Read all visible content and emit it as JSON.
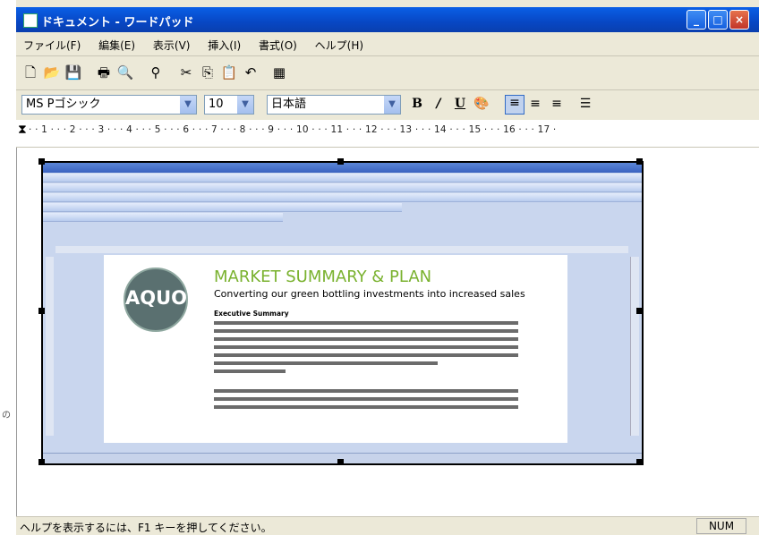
{
  "window": {
    "title": "ドキュメント - ワードパッド"
  },
  "menu": [
    "ファイル(F)",
    "編集(E)",
    "表示(V)",
    "挿入(I)",
    "書式(O)",
    "ヘルプ(H)"
  ],
  "toolbar": {
    "icons": [
      "new-icon",
      "open-icon",
      "save-icon",
      "print-icon",
      "print-preview-icon",
      "find-icon",
      "cut-icon",
      "copy-icon",
      "paste-icon",
      "undo-icon",
      "date-time-icon"
    ]
  },
  "format": {
    "font": "MS Pゴシック",
    "size": "10",
    "script": "日本語",
    "bold": "B",
    "italic": "/",
    "underline": "U"
  },
  "ruler": {
    "scale": "· · 1 · · · 2 · · · 3 · · · 4 · · · 5 · · · 6 · · · 7 · · · 8 · · · 9 · · · 10 · · · 11 · · · 12 · · · 13 · · · 14 · · · 15 · · · 16 · · · 17 ·"
  },
  "embedded": {
    "headline": "MARKET SUMMARY & PLAN",
    "subhead": "Converting our green bottling investments into increased sales",
    "logo": "AQUO",
    "section": "Executive Summary"
  },
  "status": {
    "message": "ヘルプを表示するには、F1 キーを押してください。",
    "num": "NUM"
  },
  "side_text": "の"
}
